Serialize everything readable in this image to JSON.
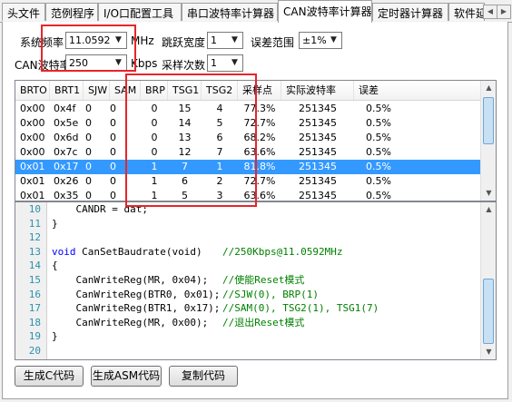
{
  "tabs": [
    "头文件",
    "范例程序",
    "I/O口配置工具",
    "串口波特率计算器",
    "CAN波特率计算器",
    "定时器计算器",
    "软件延"
  ],
  "active_tab": 4,
  "scroll_left": "◀",
  "scroll_right": "▶",
  "settings": {
    "sys_freq_label": "系统频率",
    "sys_freq_value": "11.0592",
    "sys_freq_unit": "MHz",
    "jump_width_label": "跳跃宽度",
    "jump_width_value": "1",
    "error_range_label": "误差范围",
    "error_range_value": "±1%",
    "can_baud_label": "CAN波特率",
    "can_baud_value": "250",
    "can_baud_unit": "Kbps",
    "sample_count_label": "采样次数",
    "sample_count_value": "1"
  },
  "table": {
    "columns": [
      "BRTO",
      "BRT1",
      "SJW",
      "SAM",
      "BRP",
      "TSG1",
      "TSG2",
      "采样点",
      "实际波特率",
      "误差"
    ],
    "rows": [
      [
        "0x00",
        "0x4f",
        "0",
        "0",
        "0",
        "15",
        "4",
        "77.3%",
        "251345",
        "0.5%"
      ],
      [
        "0x00",
        "0x5e",
        "0",
        "0",
        "0",
        "14",
        "5",
        "72.7%",
        "251345",
        "0.5%"
      ],
      [
        "0x00",
        "0x6d",
        "0",
        "0",
        "0",
        "13",
        "6",
        "68.2%",
        "251345",
        "0.5%"
      ],
      [
        "0x00",
        "0x7c",
        "0",
        "0",
        "0",
        "12",
        "7",
        "63.6%",
        "251345",
        "0.5%"
      ],
      [
        "0x01",
        "0x17",
        "0",
        "0",
        "1",
        "7",
        "1",
        "81.8%",
        "251345",
        "0.5%"
      ],
      [
        "0x01",
        "0x26",
        "0",
        "0",
        "1",
        "6",
        "2",
        "72.7%",
        "251345",
        "0.5%"
      ],
      [
        "0x01",
        "0x35",
        "0",
        "0",
        "1",
        "5",
        "3",
        "63.6%",
        "251345",
        "0.5%"
      ]
    ],
    "selected_row": 4
  },
  "code": [
    {
      "n": "10",
      "t": "    CANDR = dat;",
      "c": ""
    },
    {
      "n": "11",
      "t": "}",
      "c": ""
    },
    {
      "n": "12",
      "t": "",
      "c": ""
    },
    {
      "n": "13",
      "t": "void CanSetBaudrate(void)",
      "c": "//250Kbps@11.0592MHz"
    },
    {
      "n": "14",
      "t": "{",
      "c": ""
    },
    {
      "n": "15",
      "t": "    CanWriteReg(MR, 0x04);",
      "c": "//使能Reset模式"
    },
    {
      "n": "16",
      "t": "    CanWriteReg(BTR0, 0x01);",
      "c": "//SJW(0), BRP(1)"
    },
    {
      "n": "17",
      "t": "    CanWriteReg(BTR1, 0x17);",
      "c": "//SAM(0), TSG2(1), TSG1(7)"
    },
    {
      "n": "18",
      "t": "    CanWriteReg(MR, 0x00);",
      "c": "//退出Reset模式"
    },
    {
      "n": "19",
      "t": "}",
      "c": ""
    },
    {
      "n": "20",
      "t": "",
      "c": ""
    }
  ],
  "buttons": {
    "gen_c": "生成C代码",
    "gen_asm": "生成ASM代码",
    "copy": "复制代码"
  },
  "colors": {
    "selection": "#3399ff",
    "highlight_box": "#e8242a"
  }
}
